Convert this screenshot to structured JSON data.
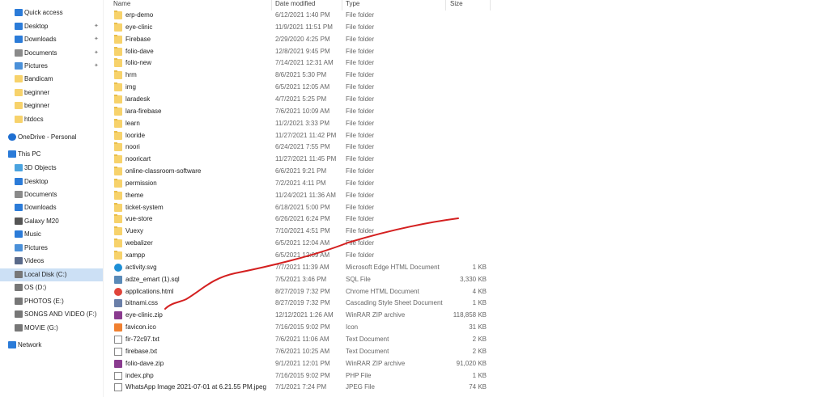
{
  "nav": {
    "items": [
      {
        "label": "Quick access",
        "icon": "star-icon",
        "color": "#2b7bd8"
      },
      {
        "label": "Desktop",
        "icon": "desktop-icon",
        "color": "#2b7bd8",
        "pinned": true
      },
      {
        "label": "Downloads",
        "icon": "download-icon",
        "color": "#2b7bd8",
        "pinned": true
      },
      {
        "label": "Documents",
        "icon": "documents-icon",
        "color": "#8a8a8a",
        "pinned": true
      },
      {
        "label": "Pictures",
        "icon": "pictures-icon",
        "color": "#4a90d9",
        "pinned": true
      },
      {
        "label": "Bandicam",
        "icon": "folder-icon",
        "color": "#f7d26b"
      },
      {
        "label": "beginner",
        "icon": "folder-icon",
        "color": "#f7d26b"
      },
      {
        "label": "beginner",
        "icon": "folder-icon",
        "color": "#f7d26b"
      },
      {
        "label": "htdocs",
        "icon": "folder-icon",
        "color": "#f7d26b"
      },
      {
        "label": "OneDrive - Personal",
        "icon": "cloud-icon",
        "color": "#1f6fd1"
      },
      {
        "label": "This PC",
        "icon": "computer-icon",
        "color": "#2b7bd8"
      },
      {
        "label": "3D Objects",
        "icon": "cube-icon",
        "color": "#4aa3df"
      },
      {
        "label": "Desktop",
        "icon": "desktop-icon",
        "color": "#2b7bd8"
      },
      {
        "label": "Documents",
        "icon": "documents-icon",
        "color": "#8a8a8a"
      },
      {
        "label": "Downloads",
        "icon": "download-icon",
        "color": "#2b7bd8"
      },
      {
        "label": "Galaxy M20",
        "icon": "phone-icon",
        "color": "#555555"
      },
      {
        "label": "Music",
        "icon": "music-icon",
        "color": "#2b7bd8"
      },
      {
        "label": "Pictures",
        "icon": "pictures-icon",
        "color": "#4a90d9"
      },
      {
        "label": "Videos",
        "icon": "videos-icon",
        "color": "#5a6a8a"
      },
      {
        "label": "Local Disk (C:)",
        "icon": "drive-icon",
        "color": "#777777",
        "selected": true
      },
      {
        "label": "OS (D:)",
        "icon": "drive-icon",
        "color": "#777777"
      },
      {
        "label": "PHOTOS (E:)",
        "icon": "drive-icon",
        "color": "#777777"
      },
      {
        "label": "SONGS AND VIDEO (F:)",
        "icon": "drive-icon",
        "color": "#777777"
      },
      {
        "label": "MOVIE (G:)",
        "icon": "drive-icon",
        "color": "#777777"
      },
      {
        "label": "Network",
        "icon": "network-icon",
        "color": "#2b7bd8"
      }
    ]
  },
  "columns": {
    "name": "Name",
    "date": "Date modified",
    "type": "Type",
    "size": "Size"
  },
  "files": [
    {
      "name": "erp-demo",
      "date": "6/12/2021 1:40 PM",
      "type": "File folder",
      "size": "",
      "icon": "folder-icon"
    },
    {
      "name": "eye-clinic",
      "date": "11/9/2021 11:51 PM",
      "type": "File folder",
      "size": "",
      "icon": "folder-icon"
    },
    {
      "name": "Firebase",
      "date": "2/29/2020 4:25 PM",
      "type": "File folder",
      "size": "",
      "icon": "folder-icon"
    },
    {
      "name": "folio-dave",
      "date": "12/8/2021 9:45 PM",
      "type": "File folder",
      "size": "",
      "icon": "folder-icon"
    },
    {
      "name": "folio-new",
      "date": "7/14/2021 12:31 AM",
      "type": "File folder",
      "size": "",
      "icon": "folder-icon"
    },
    {
      "name": "hrm",
      "date": "8/6/2021 5:30 PM",
      "type": "File folder",
      "size": "",
      "icon": "folder-icon"
    },
    {
      "name": "img",
      "date": "6/5/2021 12:05 AM",
      "type": "File folder",
      "size": "",
      "icon": "folder-icon"
    },
    {
      "name": "laradesk",
      "date": "4/7/2021 5:25 PM",
      "type": "File folder",
      "size": "",
      "icon": "folder-icon"
    },
    {
      "name": "lara-firebase",
      "date": "7/6/2021 10:09 AM",
      "type": "File folder",
      "size": "",
      "icon": "folder-icon"
    },
    {
      "name": "learn",
      "date": "11/2/2021 3:33 PM",
      "type": "File folder",
      "size": "",
      "icon": "folder-icon"
    },
    {
      "name": "looride",
      "date": "11/27/2021 11:42 PM",
      "type": "File folder",
      "size": "",
      "icon": "folder-icon"
    },
    {
      "name": "noori",
      "date": "6/24/2021 7:55 PM",
      "type": "File folder",
      "size": "",
      "icon": "folder-icon"
    },
    {
      "name": "nooricart",
      "date": "11/27/2021 11:45 PM",
      "type": "File folder",
      "size": "",
      "icon": "folder-icon"
    },
    {
      "name": "online-classroom-software",
      "date": "6/6/2021 9:21 PM",
      "type": "File folder",
      "size": "",
      "icon": "folder-icon"
    },
    {
      "name": "permission",
      "date": "7/2/2021 4:11 PM",
      "type": "File folder",
      "size": "",
      "icon": "folder-icon"
    },
    {
      "name": "theme",
      "date": "11/24/2021 11:36 AM",
      "type": "File folder",
      "size": "",
      "icon": "folder-icon"
    },
    {
      "name": "ticket-system",
      "date": "6/18/2021 5:00 PM",
      "type": "File folder",
      "size": "",
      "icon": "folder-icon"
    },
    {
      "name": "vue-store",
      "date": "6/26/2021 6:24 PM",
      "type": "File folder",
      "size": "",
      "icon": "folder-icon"
    },
    {
      "name": "Vuexy",
      "date": "7/10/2021 4:51 PM",
      "type": "File folder",
      "size": "",
      "icon": "folder-icon"
    },
    {
      "name": "webalizer",
      "date": "6/5/2021 12:04 AM",
      "type": "File folder",
      "size": "",
      "icon": "folder-icon"
    },
    {
      "name": "xampp",
      "date": "6/5/2021 12:09 AM",
      "type": "File folder",
      "size": "",
      "icon": "folder-icon"
    },
    {
      "name": "activity.svg",
      "date": "7/7/2021 11:39 AM",
      "type": "Microsoft Edge HTML Document",
      "size": "1 KB",
      "icon": "edge-icon"
    },
    {
      "name": "adze_emart (1).sql",
      "date": "7/5/2021 3:46 PM",
      "type": "SQL File",
      "size": "3,330 KB",
      "icon": "sql-icon"
    },
    {
      "name": "applications.html",
      "date": "8/27/2019 7:32 PM",
      "type": "Chrome HTML Document",
      "size": "4 KB",
      "icon": "chrome-icon"
    },
    {
      "name": "bitnami.css",
      "date": "8/27/2019 7:32 PM",
      "type": "Cascading Style Sheet Document",
      "size": "1 KB",
      "icon": "css-icon"
    },
    {
      "name": "eye-clinic.zip",
      "date": "12/12/2021 1:26 AM",
      "type": "WinRAR ZIP archive",
      "size": "118,858 KB",
      "icon": "winrar-icon"
    },
    {
      "name": "favicon.ico",
      "date": "7/16/2015 9:02 PM",
      "type": "Icon",
      "size": "31 KB",
      "icon": "xampp-icon"
    },
    {
      "name": "fir-72c97.txt",
      "date": "7/6/2021 11:06 AM",
      "type": "Text Document",
      "size": "2 KB",
      "icon": "text-icon"
    },
    {
      "name": "firebase.txt",
      "date": "7/6/2021 10:25 AM",
      "type": "Text Document",
      "size": "2 KB",
      "icon": "text-icon"
    },
    {
      "name": "folio-dave.zip",
      "date": "9/1/2021 12:01 PM",
      "type": "WinRAR ZIP archive",
      "size": "91,020 KB",
      "icon": "winrar-icon"
    },
    {
      "name": "index.php",
      "date": "7/16/2015 9:02 PM",
      "type": "PHP File",
      "size": "1 KB",
      "icon": "file-icon"
    },
    {
      "name": "WhatsApp Image 2021-07-01 at 6.21.55 PM.jpeg",
      "date": "7/1/2021 7:24 PM",
      "type": "JPEG File",
      "size": "74 KB",
      "icon": "image-icon"
    }
  ],
  "annotation_color": "#d42020"
}
